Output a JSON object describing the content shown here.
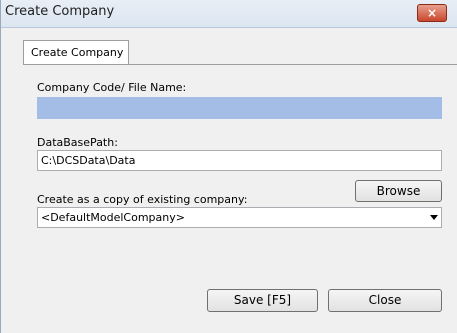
{
  "window": {
    "title": "Create Company",
    "close_glyph": "×"
  },
  "tabs": [
    {
      "label": "Create Company"
    }
  ],
  "form": {
    "company_code_label": "Company Code/ File Name:",
    "company_code_value": "",
    "database_path_label": "DataBasePath:",
    "database_path_value": "C:\\DCSData\\Data",
    "browse_label": "Browse",
    "copy_label": "Create as a copy of existing company:",
    "copy_selected": "<DefaultModelCompany>"
  },
  "actions": {
    "save_label": "Save [F5]",
    "close_label": "Close"
  }
}
